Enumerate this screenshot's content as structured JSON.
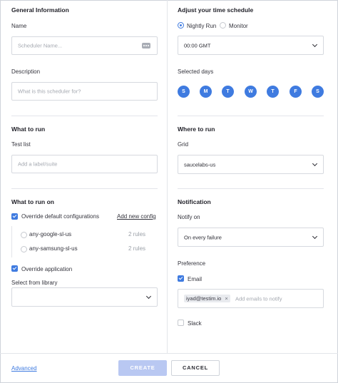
{
  "general": {
    "title": "General Information",
    "name_label": "Name",
    "name_placeholder": "Scheduler Name...",
    "description_label": "Description",
    "description_placeholder": "What is this scheduler for?"
  },
  "what_to_run": {
    "title": "What to run",
    "test_list_label": "Test list",
    "test_list_placeholder": "Add a label/suite"
  },
  "what_to_run_on": {
    "title": "What to run on",
    "override_configs_label": "Override default configurations",
    "add_new_config_link": "Add new config",
    "configs": [
      {
        "name": "any-google-sl-us",
        "rules": "2 rules"
      },
      {
        "name": "any-samsung-sl-us",
        "rules": "2 rules"
      }
    ],
    "override_application_label": "Override application",
    "select_library_label": "Select from library"
  },
  "schedule": {
    "title": "Adjust your time schedule",
    "option_nightly": "Nightly Run",
    "option_monitor": "Monitor",
    "time_value": "00:00 GMT",
    "selected_days_label": "Selected days",
    "days": [
      "S",
      "M",
      "T",
      "W",
      "T",
      "F",
      "S"
    ]
  },
  "where_to_run": {
    "title": "Where to run",
    "grid_label": "Grid",
    "grid_value": "saucelabs-us"
  },
  "notification": {
    "title": "Notification",
    "notify_on_label": "Notify on",
    "notify_on_value": "On every failure",
    "preference_label": "Preference",
    "email_label": "Email",
    "email_tag": "iyad@testim.io",
    "email_tag_remove": "×",
    "email_placeholder": "Add emails to notify",
    "slack_label": "Slack"
  },
  "footer": {
    "advanced_link": "Advanced",
    "create_button": "CREATE",
    "cancel_button": "CANCEL"
  }
}
